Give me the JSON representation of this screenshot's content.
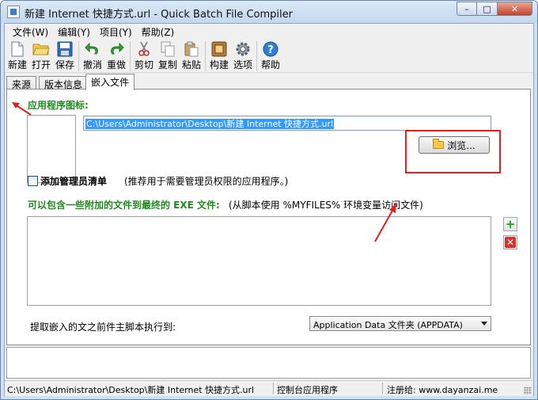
{
  "window": {
    "title": "新建 Internet 快捷方式.url - Quick Batch File Compiler",
    "minimize_glyph": "–",
    "maximize_glyph": "□",
    "close_glyph": "✕"
  },
  "menu": [
    "文件(W)",
    "编辑(Y)",
    "项目(Y)",
    "帮助(Z)"
  ],
  "toolbar": {
    "new": "新建",
    "open": "打开",
    "save": "保存",
    "undo": "撤消",
    "redo": "重做",
    "cut": "剪切",
    "copy": "复制",
    "paste": "粘贴",
    "build": "构建",
    "options": "选项",
    "help": "帮助"
  },
  "tabs": [
    "来源",
    "版本信息",
    "嵌入文件"
  ],
  "embed": {
    "icon_label": "应用程序图标:",
    "icon_path": "C:\\Users\\Administrator\\Desktop\\新建 Internet 快捷方式.url",
    "browse_label": "浏览...",
    "admin_manifest_label": "添加管理员清单",
    "admin_manifest_hint": "(推荐用于需要管理员权限的应用程序。)",
    "admin_manifest_checked": false,
    "files_label": "可以包含一些附加的文件到最终的 EXE 文件:",
    "files_hint": "(从脚本使用 %MYFILES% 环境变量访问文件)",
    "add_glyph": "+",
    "remove_glyph": "✕",
    "extract_label": "提取嵌入的文之前件主脚本执行到:",
    "extract_selected": "Application Data 文件夹 (APPDATA)"
  },
  "status": {
    "path": "C:\\Users\\Administrator\\Desktop\\新建 Internet 快捷方式.url",
    "mode": "控制台应用程序",
    "registered": "注册给: www.dayanzai.me"
  },
  "annotation_color": "#e02020"
}
